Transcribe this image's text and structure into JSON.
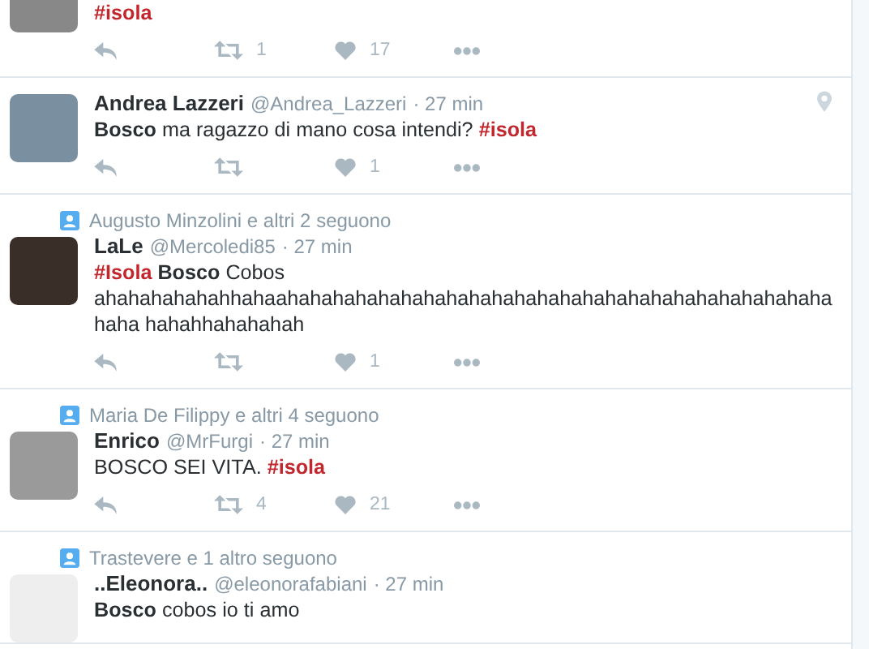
{
  "tweets": [
    {
      "partial": true,
      "text": [
        {
          "kind": "hashtag",
          "text": "#isola"
        }
      ],
      "actions": {
        "retweets": "1",
        "likes": "17"
      }
    },
    {
      "name": "Andrea Lazzeri",
      "handle": "@Andrea_Lazzeri",
      "time": "· 27 min",
      "location": true,
      "text": [
        {
          "kind": "bold",
          "text": "Bosco"
        },
        {
          "kind": "plain",
          "text": " ma ragazzo di mano cosa intendi? "
        },
        {
          "kind": "hashtag",
          "text": "#isola"
        }
      ],
      "actions": {
        "likes": "1"
      }
    },
    {
      "context": "Augusto Minzolini e altri 2 seguono",
      "name": "LaLe",
      "handle": "@Mercoledi85",
      "time": "· 27 min",
      "text": [
        {
          "kind": "hashtag",
          "text": "#Isola"
        },
        {
          "kind": "bold",
          "text": " Bosco"
        },
        {
          "kind": "plain",
          "text": " Cobos ahahahahahahhahaahahahahahahahahahahahahahahahahahahahahahahahahahaha hahahhahahahah"
        }
      ],
      "actions": {
        "likes": "1"
      }
    },
    {
      "context": "Maria De Filippy e altri 4 seguono",
      "name": "Enrico",
      "handle": "@MrFurgi",
      "time": "· 27 min",
      "text": [
        {
          "kind": "plain",
          "text": "BOSCO SEI VITA. "
        },
        {
          "kind": "hashtag",
          "text": "#isola"
        }
      ],
      "actions": {
        "retweets": "4",
        "likes": "21"
      }
    },
    {
      "context": "Trastevere e 1 altro seguono",
      "name": "..Eleonora..",
      "handle": "@eleonorafabiani",
      "time": "· 27 min",
      "text": [
        {
          "kind": "bold",
          "text": "Bosco"
        },
        {
          "kind": "plain",
          "text": " cobos io ti amo"
        }
      ]
    }
  ]
}
